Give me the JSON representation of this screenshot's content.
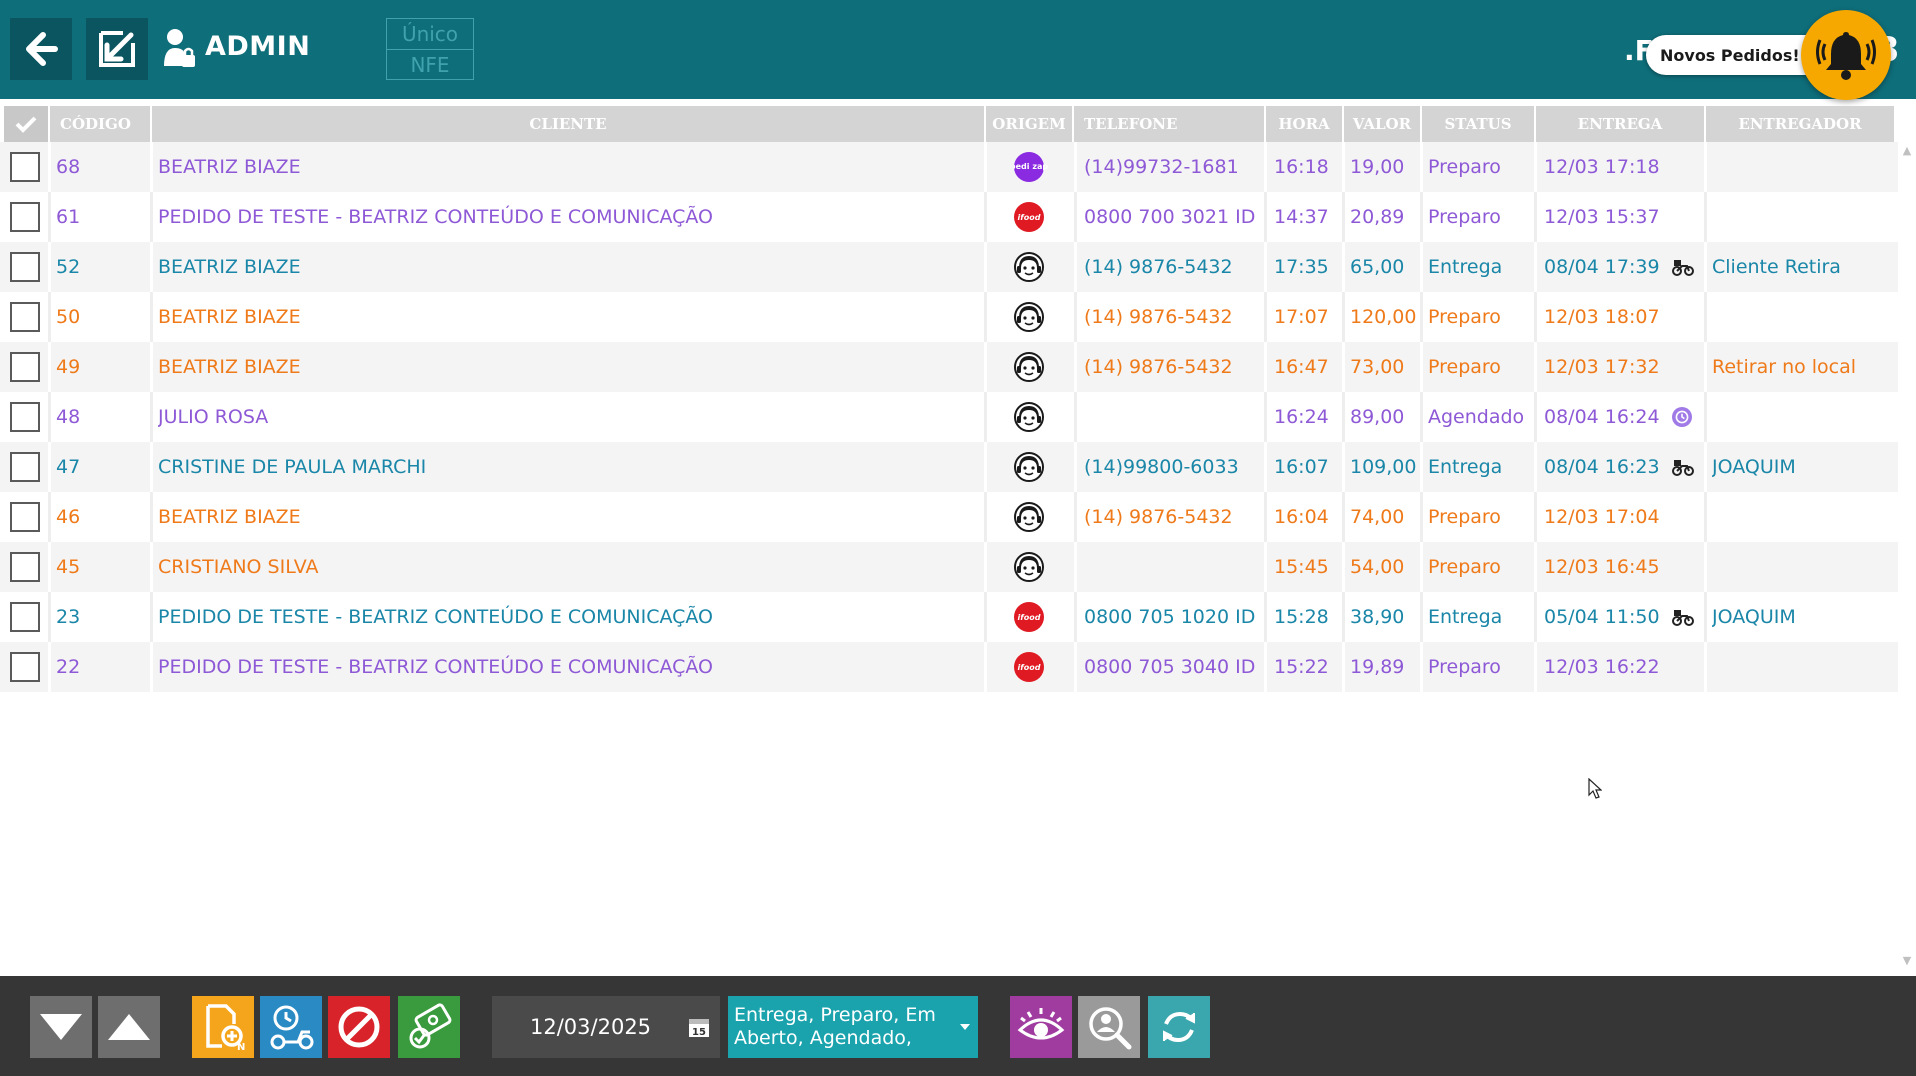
{
  "header": {
    "user_label": "ADMIN",
    "mode_options": [
      "Único",
      "NFE"
    ],
    "brand_partial_left": ".F",
    "brand_partial_right": "3",
    "notification_text": "Novos Pedidos!"
  },
  "table": {
    "columns": [
      "CÓDIGO",
      "CLIENTE",
      "ORIGEM",
      "TELEFONE",
      "HORA",
      "VALOR",
      "STATUS",
      "ENTREGA",
      "ENTREGADOR"
    ],
    "rows": [
      {
        "codigo": "68",
        "cliente": "BEATRIZ BIAZE",
        "origem": "pedizap",
        "origem_label": "pedi zap",
        "telefone": "(14)99732-1681",
        "hora": "16:18",
        "valor": "19,00",
        "status": "Preparo",
        "entrega": "12/03 17:18",
        "entrega_icon": "",
        "entregador": "",
        "color": "#8e59d6"
      },
      {
        "codigo": "61",
        "cliente": "PEDIDO DE TESTE - BEATRIZ CONTEÚDO E COMUNICAÇÃO",
        "origem": "ifood",
        "origem_label": "ifood",
        "telefone": "0800 700 3021 ID",
        "hora": "14:37",
        "valor": "20,89",
        "status": "Preparo",
        "entrega": "12/03 15:37",
        "entrega_icon": "",
        "entregador": "",
        "color": "#8e59d6"
      },
      {
        "codigo": "52",
        "cliente": "BEATRIZ BIAZE",
        "origem": "atendente",
        "origem_label": "",
        "telefone": "(14) 9876-5432",
        "hora": "17:35",
        "valor": "65,00",
        "status": "Entrega",
        "entrega": "08/04 17:39",
        "entrega_icon": "motorcycle-icon",
        "entregador": "Cliente Retira",
        "color": "#1a86a8"
      },
      {
        "codigo": "50",
        "cliente": "BEATRIZ BIAZE",
        "origem": "atendente",
        "origem_label": "",
        "telefone": "(14) 9876-5432",
        "hora": "17:07",
        "valor": "120,00",
        "status": "Preparo",
        "entrega": "12/03 18:07",
        "entrega_icon": "",
        "entregador": "",
        "color": "#ef7a1a"
      },
      {
        "codigo": "49",
        "cliente": "BEATRIZ BIAZE",
        "origem": "atendente",
        "origem_label": "",
        "telefone": "(14) 9876-5432",
        "hora": "16:47",
        "valor": "73,00",
        "status": "Preparo",
        "entrega": "12/03 17:32",
        "entrega_icon": "",
        "entregador": "Retirar no local",
        "color": "#ef7a1a"
      },
      {
        "codigo": "48",
        "cliente": "JULIO ROSA",
        "origem": "atendente",
        "origem_label": "",
        "telefone": "",
        "hora": "16:24",
        "valor": "89,00",
        "status": "Agendado",
        "entrega": "08/04 16:24",
        "entrega_icon": "schedule-icon",
        "entregador": "",
        "color": "#8e59d6"
      },
      {
        "codigo": "47",
        "cliente": "CRISTINE DE PAULA MARCHI",
        "origem": "atendente",
        "origem_label": "",
        "telefone": "(14)99800-6033",
        "hora": "16:07",
        "valor": "109,00",
        "status": "Entrega",
        "entrega": "08/04 16:23",
        "entrega_icon": "motorcycle-icon",
        "entregador": "JOAQUIM",
        "color": "#1a86a8"
      },
      {
        "codigo": "46",
        "cliente": "BEATRIZ BIAZE",
        "origem": "atendente",
        "origem_label": "",
        "telefone": "(14) 9876-5432",
        "hora": "16:04",
        "valor": "74,00",
        "status": "Preparo",
        "entrega": "12/03 17:04",
        "entrega_icon": "",
        "entregador": "",
        "color": "#ef7a1a"
      },
      {
        "codigo": "45",
        "cliente": "CRISTIANO SILVA",
        "origem": "atendente",
        "origem_label": "",
        "telefone": "",
        "hora": "15:45",
        "valor": "54,00",
        "status": "Preparo",
        "entrega": "12/03 16:45",
        "entrega_icon": "",
        "entregador": "",
        "color": "#ef7a1a"
      },
      {
        "codigo": "23",
        "cliente": "PEDIDO DE TESTE - BEATRIZ CONTEÚDO E COMUNICAÇÃO",
        "origem": "ifood",
        "origem_label": "ifood",
        "telefone": "0800 705 1020 ID",
        "hora": "15:28",
        "valor": "38,90",
        "status": "Entrega",
        "entrega": "05/04 11:50",
        "entrega_icon": "motorcycle-icon",
        "entregador": "JOAQUIM",
        "color": "#1a86a8"
      },
      {
        "codigo": "22",
        "cliente": "PEDIDO DE TESTE - BEATRIZ CONTEÚDO E COMUNICAÇÃO",
        "origem": "ifood",
        "origem_label": "ifood",
        "telefone": "0800 705 3040 ID",
        "hora": "15:22",
        "valor": "19,89",
        "status": "Preparo",
        "entrega": "12/03 16:22",
        "entrega_icon": "",
        "entregador": "",
        "color": "#8e59d6"
      }
    ]
  },
  "footer": {
    "date_value": "12/03/2025",
    "calendar_day": "15",
    "status_filter_value": "Entrega, Preparo, Em Aberto, Agendado,",
    "buttons": [
      {
        "name": "scroll-down-button",
        "icon": "triangle-down-icon",
        "color": "#6e6e6e"
      },
      {
        "name": "scroll-up-button",
        "icon": "triangle-up-icon",
        "color": "#6e6e6e"
      },
      {
        "name": "new-order-button",
        "icon": "new-document-icon",
        "color": "#f5a51c"
      },
      {
        "name": "dispatch-button",
        "icon": "delivery-clock-icon",
        "color": "#2a8ac4"
      },
      {
        "name": "cancel-order-button",
        "icon": "prohibited-icon",
        "color": "#d9232a"
      },
      {
        "name": "payment-button",
        "icon": "money-check-icon",
        "color": "#3a9a3e"
      },
      {
        "name": "view-button",
        "icon": "eye-icon",
        "color": "#a03ca0"
      },
      {
        "name": "search-client-button",
        "icon": "magnifier-person-icon",
        "color": "#9a9a9a"
      },
      {
        "name": "refresh-button",
        "icon": "refresh-icon",
        "color": "#3aa6ad"
      }
    ]
  },
  "colors": {
    "header_bg": "#0e6e7a",
    "footer_bg": "#363636",
    "bell": "#f7a800"
  }
}
